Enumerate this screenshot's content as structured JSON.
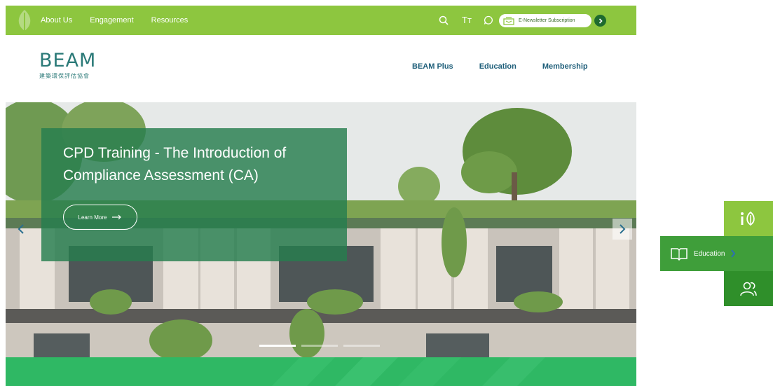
{
  "topbar": {
    "nav": [
      "About Us",
      "Engagement",
      "Resources"
    ],
    "tools": {
      "search_icon": "search-icon",
      "font_size_label": "Tт",
      "chat_icon": "chat-icon"
    },
    "newsletter_label": "E-Newsletter Subscription"
  },
  "header": {
    "logo_text": "BEAM",
    "logo_sub": "建築環保評估協會",
    "nav": [
      "BEAM Plus",
      "Education",
      "Membership"
    ]
  },
  "hero": {
    "title": "CPD Training - The Introduction of Compliance Assessment (CA)",
    "cta_label": "Learn More",
    "slides_total": 3,
    "slide_active": 1
  },
  "side_widget": {
    "education_label": "Education"
  },
  "colors": {
    "topbar": "#8dc63f",
    "brand": "#2b7a78",
    "nav": "#1f5f7a",
    "caption": "#267e4e",
    "band": "#2fb864"
  }
}
